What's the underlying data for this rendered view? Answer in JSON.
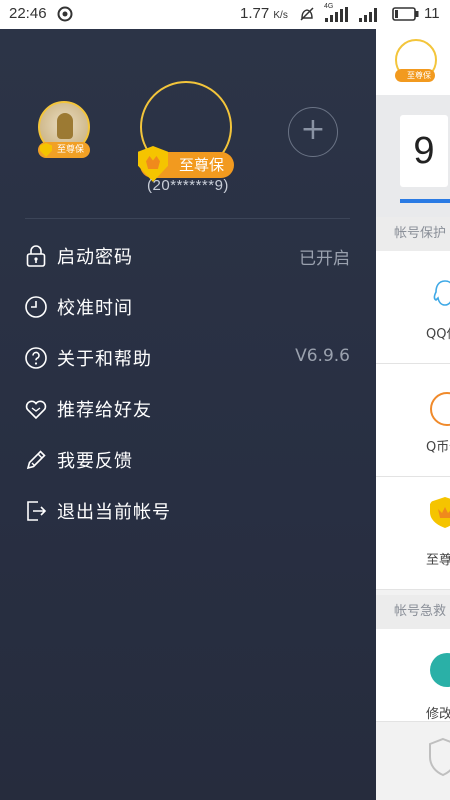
{
  "status_bar": {
    "time": "22:46",
    "network_speed": "1.77",
    "speed_unit": "K/s",
    "signal_label": "4G",
    "battery_text": "11"
  },
  "drawer": {
    "small_avatar_badge": "至尊保",
    "big_avatar_badge": "至尊保",
    "add_icon": "plus-circle-icon",
    "account_id": "(20*******9)",
    "menu": [
      {
        "icon": "lock-icon",
        "label": "启动密码",
        "value": "已开启"
      },
      {
        "icon": "clock-icon",
        "label": "校准时间",
        "value": ""
      },
      {
        "icon": "help-icon",
        "label": "关于和帮助",
        "value": "V6.9.6"
      },
      {
        "icon": "heart-icon",
        "label": "推荐给好友",
        "value": ""
      },
      {
        "icon": "pencil-icon",
        "label": "我要反馈",
        "value": ""
      },
      {
        "icon": "logout-icon",
        "label": "退出当前帐号",
        "value": ""
      }
    ]
  },
  "main": {
    "avatar_badge": "至尊保",
    "code_digit": "9",
    "section1": "帐号保护",
    "card1_label": "QQ保",
    "card2_label": "Q币保",
    "card3_label": "至尊",
    "section2": "帐号急救",
    "card4_label": "修改"
  },
  "colors": {
    "drawer_bg": "#2a3244",
    "accent_gold": "#f3c53b",
    "badge_orange": "#f29a1f",
    "progress_blue": "#2a7be4"
  }
}
